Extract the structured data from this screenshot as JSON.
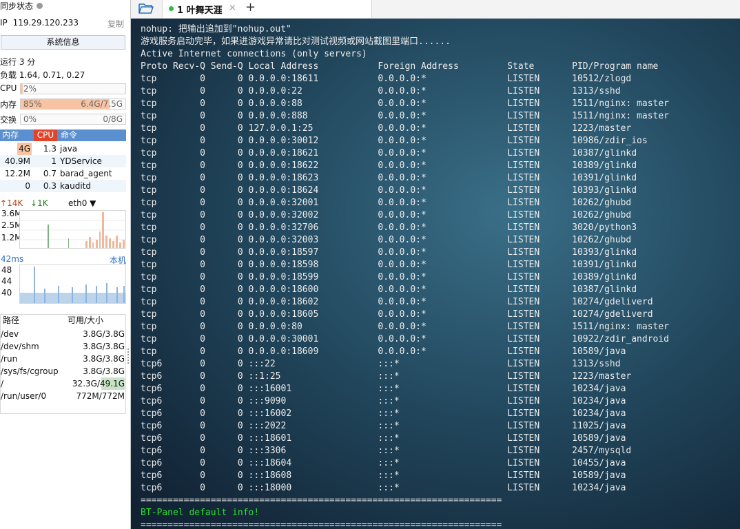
{
  "sidebar": {
    "sync_label": "同步状态",
    "ip_label": "IP",
    "ip_value": "119.29.120.233",
    "copy_label": "复制",
    "sysinfo_button": "系统信息",
    "uptime": "运行 3 分",
    "load_label": "负载",
    "load_values": "1.64, 0.71, 0.27",
    "cpu": {
      "label": "CPU",
      "text": "2%",
      "percent": 2
    },
    "mem": {
      "label": "内存",
      "text": "85%",
      "detail": "6.4G/7.5G",
      "percent": 85
    },
    "swap": {
      "label": "交换",
      "text": "0%",
      "detail": "0/8G",
      "percent": 0
    },
    "process_headers": {
      "mem": "内存",
      "cpu": "CPU",
      "cmd": "命令"
    },
    "processes": [
      {
        "mem": "4G",
        "cpu": "1.3",
        "cmd": "java"
      },
      {
        "mem": "40.9M",
        "cpu": "1",
        "cmd": "YDService"
      },
      {
        "mem": "12.2M",
        "cpu": "0.7",
        "cmd": "barad_agent"
      },
      {
        "mem": "0",
        "cpu": "0.3",
        "cmd": "kauditd"
      }
    ],
    "net": {
      "up": "14K",
      "down": "1K",
      "iface": "eth0",
      "ticks": [
        "3.6M",
        "2.5M",
        "1.2M"
      ]
    },
    "latency": {
      "value": "42ms",
      "target": "本机",
      "ticks": [
        "48",
        "44",
        "40"
      ]
    },
    "fs_headers": {
      "path": "路径",
      "size": "可用/大小"
    },
    "filesystems": [
      {
        "path": "/dev",
        "size": "3.8G/3.8G"
      },
      {
        "path": "/dev/shm",
        "size": "3.8G/3.8G"
      },
      {
        "path": "/run",
        "size": "3.8G/3.8G"
      },
      {
        "path": "/sys/fs/cgroup",
        "size": "3.8G/3.8G"
      },
      {
        "path": "/",
        "size": "32.3G/49.1G"
      },
      {
        "path": "/run/user/0",
        "size": "772M/772M"
      }
    ]
  },
  "tabs": [
    {
      "label": "1 叶舞天涯"
    }
  ],
  "terminal": {
    "lines": [
      "nohup: 把输出追加到\"nohup.out\"",
      "游戏服务启动完毕，如果进游戏异常请比对测试视频或网站截图里端口......",
      "Active Internet connections (only servers)",
      "Proto Recv-Q Send-Q Local Address           Foreign Address         State       PID/Program name",
      "tcp        0      0 0.0.0.0:18611           0.0.0.0:*               LISTEN      10512/zlogd",
      "tcp        0      0 0.0.0.0:22              0.0.0.0:*               LISTEN      1313/sshd",
      "tcp        0      0 0.0.0.0:88              0.0.0.0:*               LISTEN      1511/nginx: master",
      "tcp        0      0 0.0.0.0:888             0.0.0.0:*               LISTEN      1511/nginx: master",
      "tcp        0      0 127.0.0.1:25            0.0.0.0:*               LISTEN      1223/master",
      "tcp        0      0 0.0.0.0:30012           0.0.0.0:*               LISTEN      10986/zdir_ios",
      "tcp        0      0 0.0.0.0:18621           0.0.0.0:*               LISTEN      10387/glinkd",
      "tcp        0      0 0.0.0.0:18622           0.0.0.0:*               LISTEN      10389/glinkd",
      "tcp        0      0 0.0.0.0:18623           0.0.0.0:*               LISTEN      10391/glinkd",
      "tcp        0      0 0.0.0.0:18624           0.0.0.0:*               LISTEN      10393/glinkd",
      "tcp        0      0 0.0.0.0:32001           0.0.0.0:*               LISTEN      10262/ghubd",
      "tcp        0      0 0.0.0.0:32002           0.0.0.0:*               LISTEN      10262/ghubd",
      "tcp        0      0 0.0.0.0:32706           0.0.0.0:*               LISTEN      3020/python3",
      "tcp        0      0 0.0.0.0:32003           0.0.0.0:*               LISTEN      10262/ghubd",
      "tcp        0      0 0.0.0.0:18597           0.0.0.0:*               LISTEN      10393/glinkd",
      "tcp        0      0 0.0.0.0:18598           0.0.0.0:*               LISTEN      10391/glinkd",
      "tcp        0      0 0.0.0.0:18599           0.0.0.0:*               LISTEN      10389/glinkd",
      "tcp        0      0 0.0.0.0:18600           0.0.0.0:*               LISTEN      10387/glinkd",
      "tcp        0      0 0.0.0.0:18602           0.0.0.0:*               LISTEN      10274/gdeliverd",
      "tcp        0      0 0.0.0.0:18605           0.0.0.0:*               LISTEN      10274/gdeliverd",
      "tcp        0      0 0.0.0.0:80              0.0.0.0:*               LISTEN      1511/nginx: master",
      "tcp        0      0 0.0.0.0:30001           0.0.0.0:*               LISTEN      10922/zdir_android",
      "tcp        0      0 0.0.0.0:18609           0.0.0.0:*               LISTEN      10589/java",
      "tcp6       0      0 :::22                   :::*                    LISTEN      1313/sshd",
      "tcp6       0      0 ::1:25                  :::*                    LISTEN      1223/master",
      "tcp6       0      0 :::16001                :::*                    LISTEN      10234/java",
      "tcp6       0      0 :::9090                 :::*                    LISTEN      10234/java",
      "tcp6       0      0 :::16002                :::*                    LISTEN      10234/java",
      "tcp6       0      0 :::2022                 :::*                    LISTEN      11025/java",
      "tcp6       0      0 :::18601                :::*                    LISTEN      10589/java",
      "tcp6       0      0 :::3306                 :::*                    LISTEN      2457/mysqld",
      "tcp6       0      0 :::18604                :::*                    LISTEN      10455/java",
      "tcp6       0      0 :::18608                :::*                    LISTEN      10589/java",
      "tcp6       0      0 :::18000                :::*                    LISTEN      10234/java",
      "==================================================================="
    ],
    "green_line": "BT-Panel default info!",
    "last_line": "==================================================================="
  }
}
